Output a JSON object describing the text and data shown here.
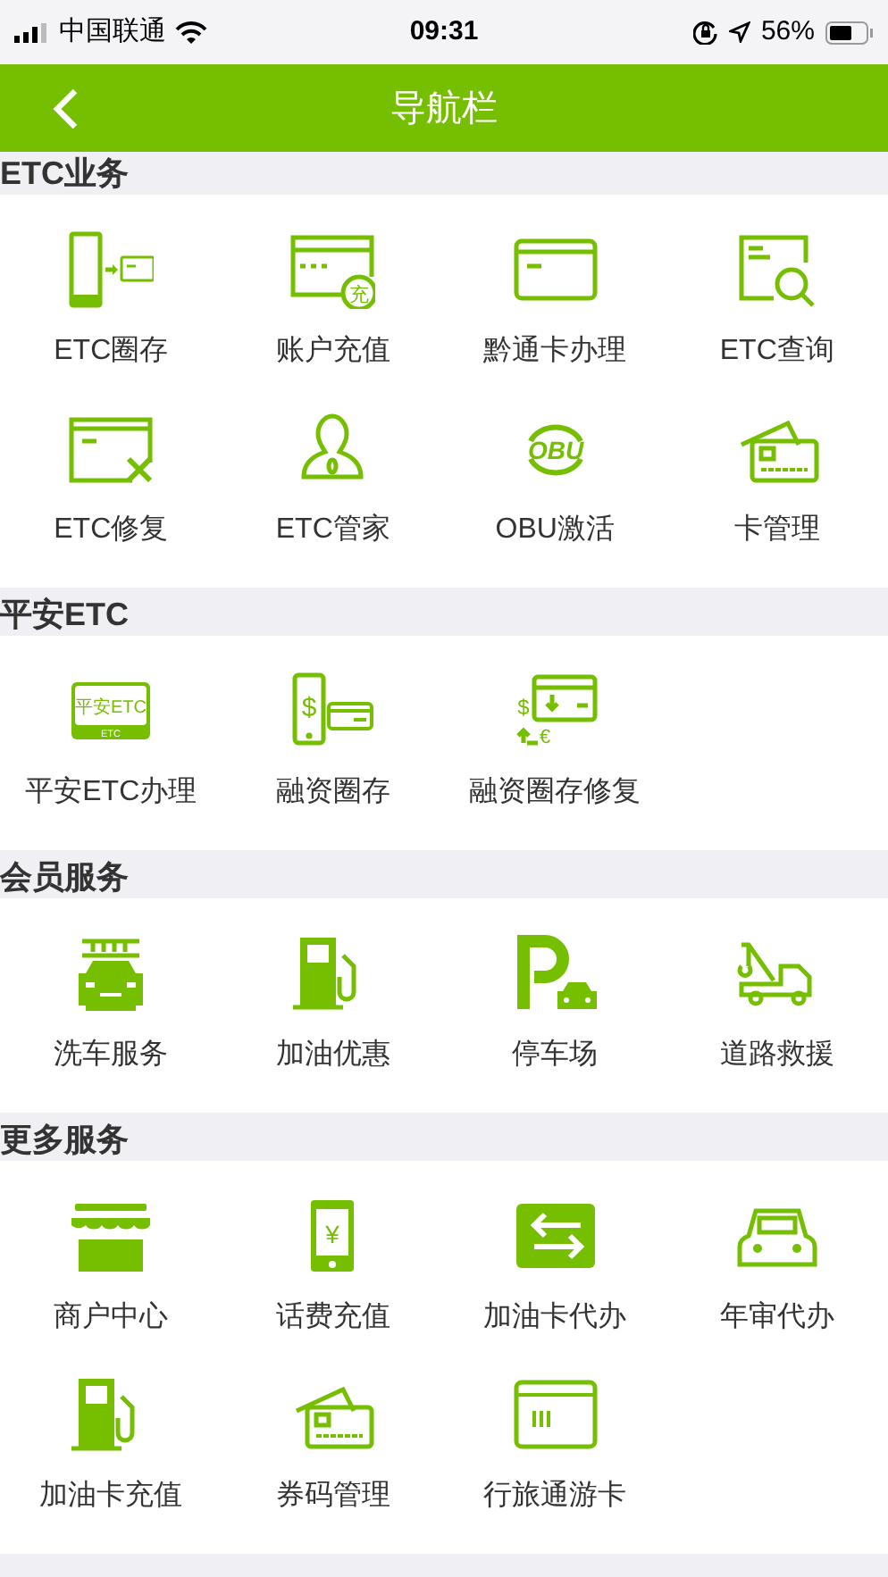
{
  "status_bar": {
    "carrier": "中国联通",
    "time": "09:31",
    "battery": "56%"
  },
  "nav_bar": {
    "title": "导航栏"
  },
  "sections": [
    {
      "title": "ETC业务",
      "items": [
        {
          "label": "ETC圈存",
          "kind": "phone-card"
        },
        {
          "label": "账户充值",
          "kind": "recharge-card",
          "icon_text": [
            "充"
          ]
        },
        {
          "label": "黔通卡办理",
          "kind": "card"
        },
        {
          "label": "ETC查询",
          "kind": "card-search"
        },
        {
          "label": "ETC修复",
          "kind": "card-tools"
        },
        {
          "label": "ETC管家",
          "kind": "person"
        },
        {
          "label": "OBU激活",
          "kind": "obu",
          "icon_text": [
            "OBU"
          ]
        },
        {
          "label": "卡管理",
          "kind": "cards"
        }
      ]
    },
    {
      "title": "平安ETC",
      "items": [
        {
          "label": "平安ETC办理",
          "kind": "pingan",
          "icon_text": [
            "平安ETC",
            "ETC"
          ]
        },
        {
          "label": "融资圈存",
          "kind": "phone-dollar",
          "icon_text": [
            "$"
          ]
        },
        {
          "label": "融资圈存修复",
          "kind": "finance-repair",
          "icon_text": [
            "$",
            "€"
          ]
        }
      ]
    },
    {
      "title": "会员服务",
      "items": [
        {
          "label": "洗车服务",
          "kind": "car-wash"
        },
        {
          "label": "加油优惠",
          "kind": "fuel"
        },
        {
          "label": "停车场",
          "kind": "parking"
        },
        {
          "label": "道路救援",
          "kind": "tow-truck"
        }
      ]
    },
    {
      "title": "更多服务",
      "items": [
        {
          "label": "商户中心",
          "kind": "shop"
        },
        {
          "label": "话费充值",
          "kind": "phone-yuan",
          "icon_text": [
            "¥"
          ]
        },
        {
          "label": "加油卡代办",
          "kind": "swap"
        },
        {
          "label": "年审代办",
          "kind": "car"
        },
        {
          "label": "加油卡充值",
          "kind": "fuel"
        },
        {
          "label": "券码管理",
          "kind": "cards"
        },
        {
          "label": "行旅通游卡",
          "kind": "stripe-card"
        }
      ]
    }
  ]
}
